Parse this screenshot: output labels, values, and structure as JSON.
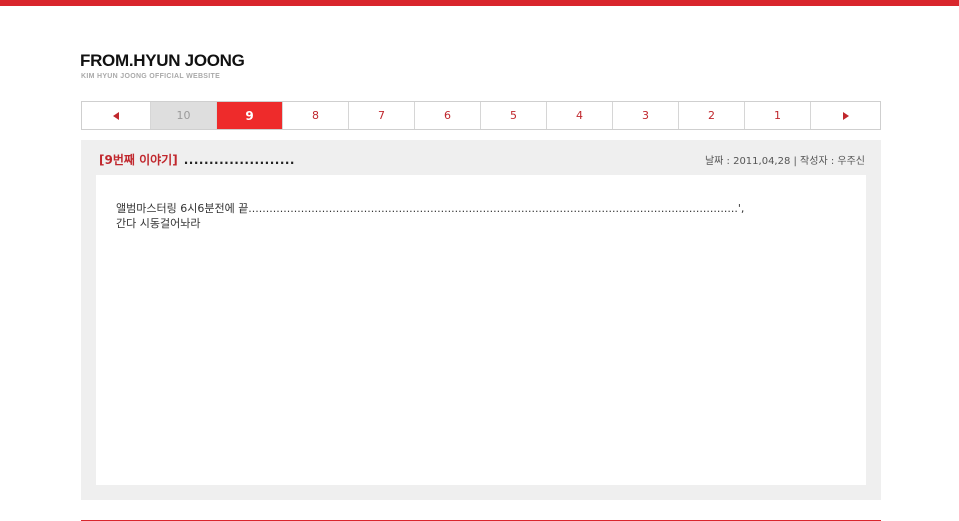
{
  "site": {
    "title": "FROM.HYUN JOONG",
    "subtitle": "KIM HYUN JOONG OFFICIAL WEBSITE"
  },
  "pager": {
    "prev_icon": "triangle-left-icon",
    "next_icon": "triangle-right-icon",
    "pages": [
      "10",
      "9",
      "8",
      "7",
      "6",
      "5",
      "4",
      "3",
      "2",
      "1"
    ],
    "current": "9"
  },
  "entry": {
    "title_bracket": "[9번째 이야기]",
    "title_dots": "......................",
    "meta": "날짜 : 2011,04,28 | 작성자 : 우주신",
    "lines": [
      "앨범마스터링 6시6분전에 끝............................................................................................................................................',",
      "간다 시동걸어놔라"
    ]
  },
  "colors": {
    "accent": "#d9262c",
    "active_page": "#ee2b2b",
    "panel_bg": "#efefef"
  }
}
